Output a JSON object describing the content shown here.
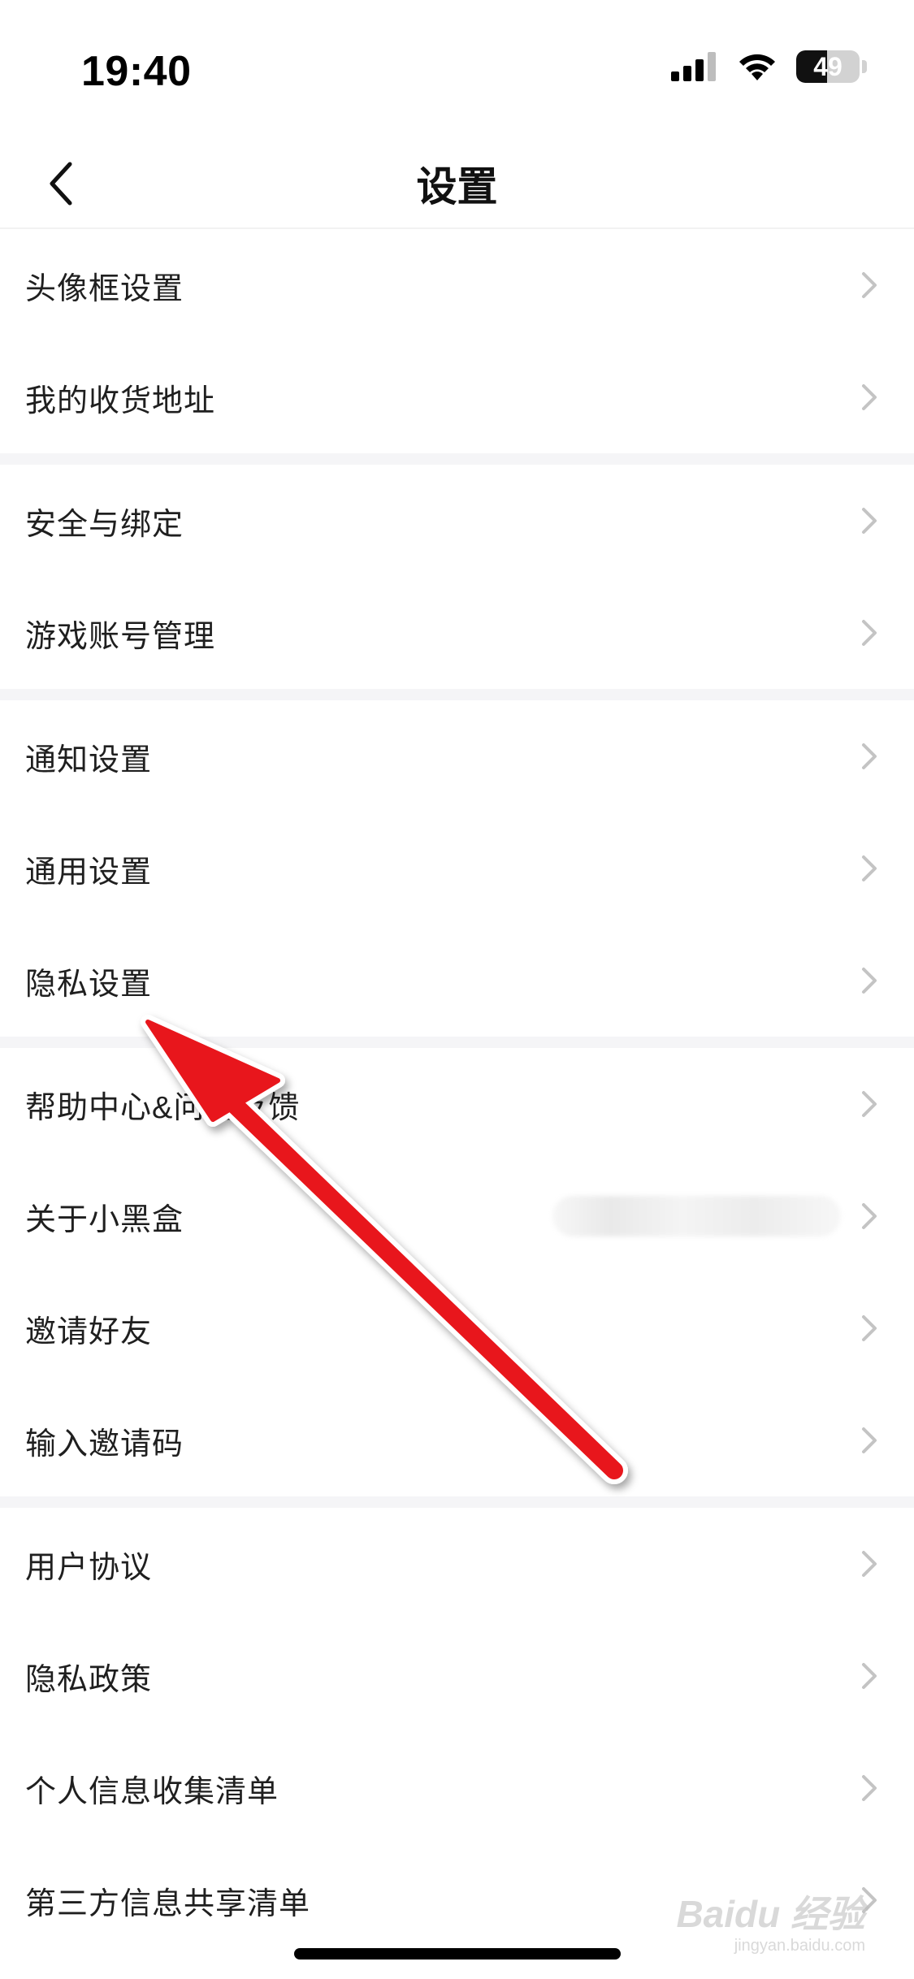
{
  "status_bar": {
    "time": "19:40",
    "battery_level": "49",
    "battery_fraction": 0.49,
    "icons": [
      "signal-icon",
      "wifi-icon",
      "battery-icon"
    ]
  },
  "nav": {
    "title": "设置",
    "back_icon": "chevron-left-icon"
  },
  "sections": [
    [
      {
        "label": "头像框设置"
      },
      {
        "label": "我的收货地址"
      }
    ],
    [
      {
        "label": "安全与绑定"
      },
      {
        "label": "游戏账号管理"
      }
    ],
    [
      {
        "label": "通知设置"
      },
      {
        "label": "通用设置"
      },
      {
        "label": "隐私设置"
      }
    ],
    [
      {
        "label": "帮助中心&问题反馈"
      },
      {
        "label": "关于小黑盒"
      },
      {
        "label": "邀请好友"
      },
      {
        "label": "输入邀请码"
      }
    ],
    [
      {
        "label": "用户协议"
      },
      {
        "label": "隐私政策"
      },
      {
        "label": "个人信息收集清单"
      },
      {
        "label": "第三方信息共享清单"
      }
    ]
  ],
  "watermark": {
    "main": "Baidu 经验",
    "sub": "jingyan.baidu.com"
  },
  "colors": {
    "background": "#ffffff",
    "section_gap": "#f5f5f7",
    "text": "#1f1f1f",
    "chevron": "#c4c4c4",
    "annotation_arrow": "#e8141b"
  }
}
